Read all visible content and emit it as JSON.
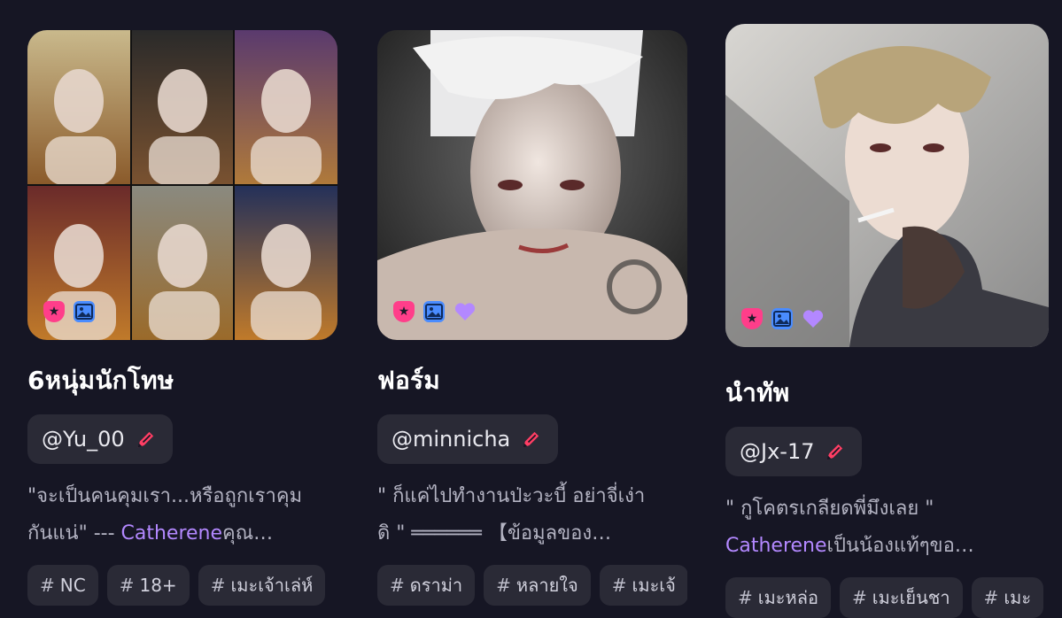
{
  "cards": [
    {
      "title": "6หนุ่มนักโทษ",
      "author": "@Yu_00",
      "desc_line1": "\"จะเป็นคนคุมเรา...หรือถูกเราคุม",
      "desc_line2_pre": "กันแน่\" --- ",
      "desc_highlight": "Catherene",
      "desc_line2_post": "คุณ…",
      "tags": [
        "NC",
        "18+",
        "เมะเจ้าเล่ห์"
      ],
      "badges": [
        "shield-icon",
        "image-icon"
      ]
    },
    {
      "title": "ฟอร์ม",
      "author": "@minnicha",
      "desc_line1": "\" ก็แค่ไปทำงานป่ะวะบี้ อย่าจี่เง่า",
      "desc_line2_pre": "ดิ \" ══════ 【ข้อมูลของ…",
      "desc_highlight": "",
      "desc_line2_post": "",
      "tags": [
        "ดราม่า",
        "หลายใจ",
        "เมะเจ้"
      ],
      "badges": [
        "shield-icon",
        "image-icon",
        "heart-icon"
      ]
    },
    {
      "title": "นำทัพ",
      "author": "@Jx-17",
      "desc_line1": "\" กูโคตรเกลียดพี่มึงเลย \"",
      "desc_line2_pre": "",
      "desc_highlight": "Catherene",
      "desc_line2_post": "เป็นน้องแท้ๆขอ…",
      "tags": [
        "เมะหล่อ",
        "เมะเย็นชา",
        "เมะ"
      ],
      "badges": [
        "shield-icon",
        "image-icon",
        "heart-icon"
      ]
    }
  ],
  "colors": {
    "background": "#161624",
    "accent": "#b388ff",
    "pen": "#ff3e64"
  }
}
